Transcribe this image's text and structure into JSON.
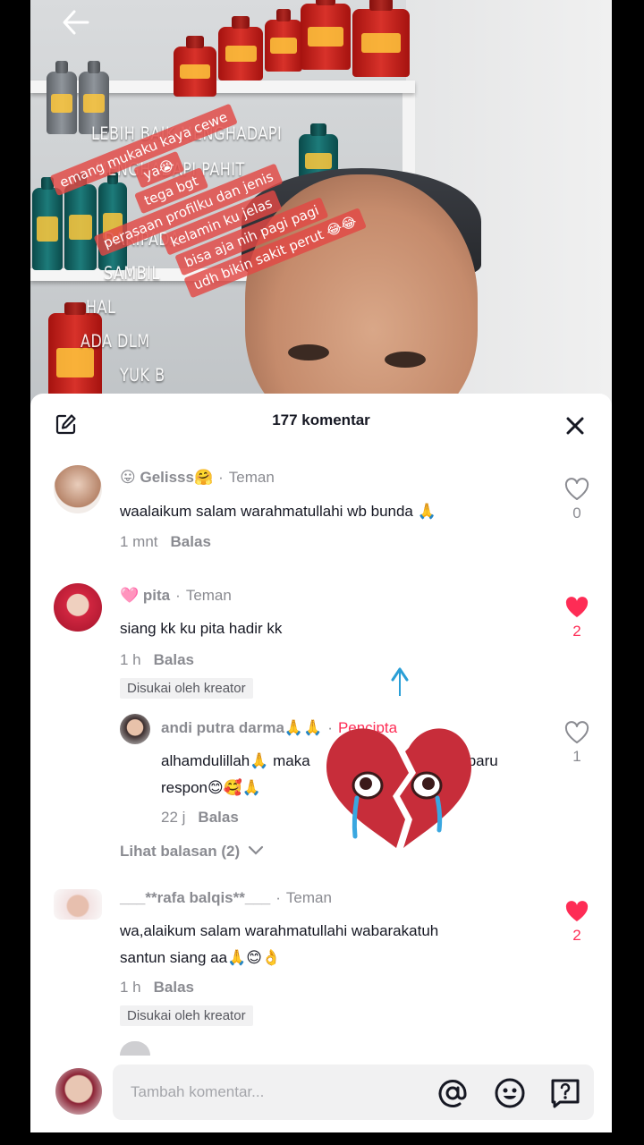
{
  "header": {
    "back_icon": "arrow-left-icon",
    "comment_count_title": "177 komentar",
    "edit_icon": "edit-icon",
    "close_icon": "close-icon"
  },
  "video": {
    "background_text": [
      "LEBIH BAIK MENGHADAPI",
      "MENGHADAPI PAHIT",
      "DARIPADA",
      "SAMBIL",
      "HAL",
      "ADA DLM",
      "YUK B"
    ],
    "caption_lines": [
      "emang mukaku kaya cewe",
      "ya😭",
      "tega bgt",
      "perasaan profilku dan jenis",
      "kelamin ku jelas",
      "bisa aja nih pagi pagi",
      "udh bikin sakit perut 😂😂"
    ]
  },
  "comments": [
    {
      "name_emoji_prefix": "😛",
      "name": "Gelisss🤗",
      "relation": "Teman",
      "text": "waalaikum salam warahmatullahi wb bunda 🙏",
      "time": "1 mnt",
      "reply_label": "Balas",
      "likes": "0",
      "liked": false
    },
    {
      "name_emoji_prefix": "🩷",
      "name": "pita",
      "relation": "Teman",
      "text": "siang kk ku pita hadir kk",
      "time": "1 h",
      "reply_label": "Balas",
      "likes": "2",
      "liked": true,
      "badge": "Disukai oleh kreator"
    },
    {
      "name": "___**rafa balqis**___",
      "relation": "Teman",
      "text_line1": "wa,alaikum salam warahmatullahi wabarakatuh",
      "text_line2": "santun siang aa🙏😊👌",
      "time": "1 h",
      "reply_label": "Balas",
      "likes": "2",
      "liked": true,
      "badge": "Disukai oleh kreator"
    }
  ],
  "reply": {
    "name": "andi putra darma🙏🙏",
    "role": "Pencipta",
    "text_line1_start": "alhamdulillah🙏 maka",
    "text_line1_end": "baru",
    "text_line2": "respon😊🥰🙏",
    "time": "22 j",
    "reply_label": "Balas",
    "likes": "1"
  },
  "view_replies": "Lihat balasan (2)",
  "input": {
    "placeholder": "Tambah komentar...",
    "icons": [
      "at-icon",
      "emoji-icon",
      "question-icon"
    ]
  },
  "colors": {
    "accent": "#fe2c55",
    "muted_text": "#8a8b91",
    "text": "#161823",
    "input_bg": "#f1f1f2"
  }
}
